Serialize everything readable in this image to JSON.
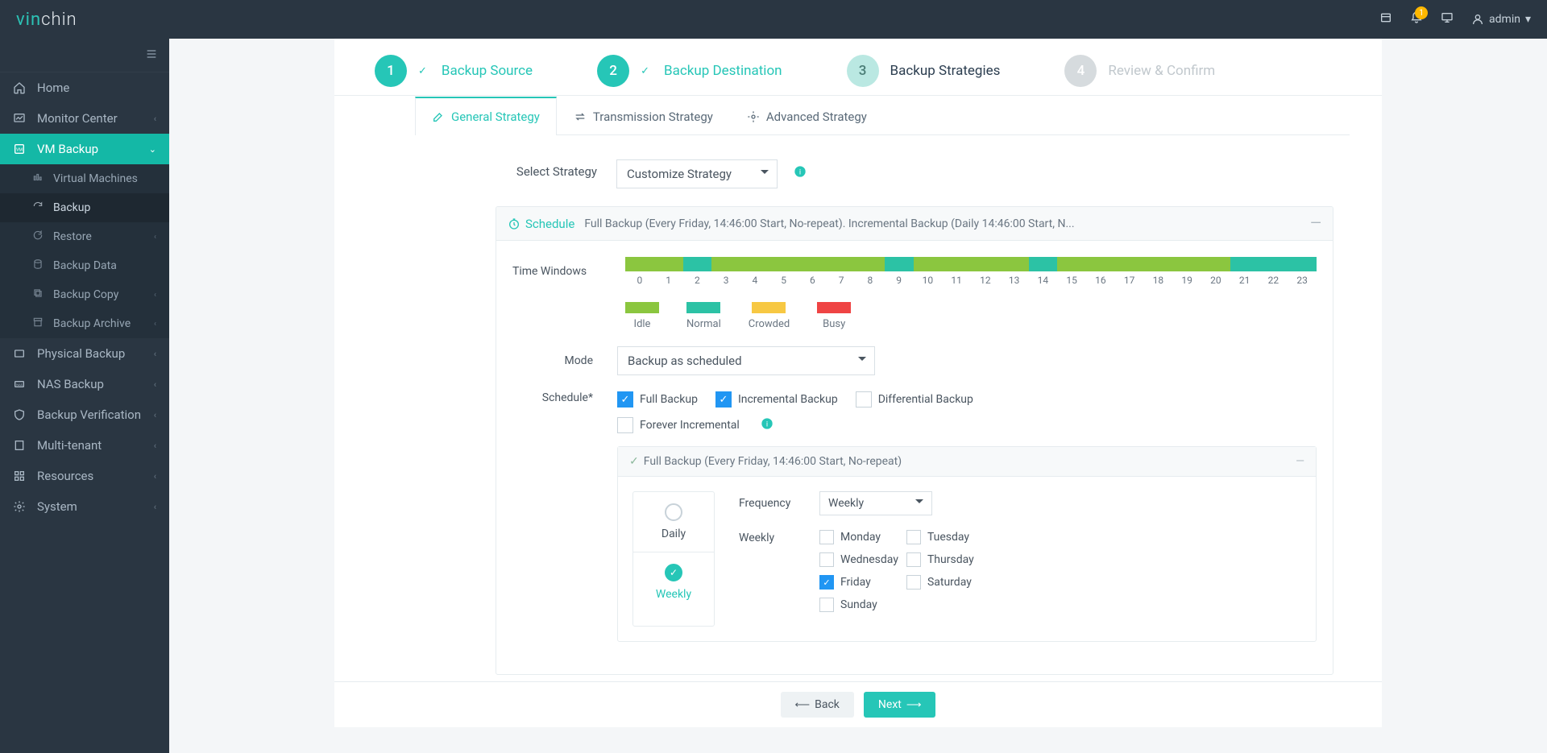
{
  "brand": {
    "prefix": "vin",
    "suffix": "chin"
  },
  "topbar": {
    "user": "admin",
    "notif_count": "1"
  },
  "sidebar": {
    "items": [
      {
        "label": "Home"
      },
      {
        "label": "Monitor Center"
      },
      {
        "label": "VM Backup"
      },
      {
        "label": "Physical Backup"
      },
      {
        "label": "NAS Backup"
      },
      {
        "label": "Backup Verification"
      },
      {
        "label": "Multi-tenant"
      },
      {
        "label": "Resources"
      },
      {
        "label": "System"
      }
    ],
    "vm_sub": [
      {
        "label": "Virtual Machines"
      },
      {
        "label": "Backup"
      },
      {
        "label": "Restore"
      },
      {
        "label": "Backup Data"
      },
      {
        "label": "Backup Copy"
      },
      {
        "label": "Backup Archive"
      }
    ]
  },
  "wizard": {
    "steps": [
      {
        "num": "1",
        "label": "Backup Source"
      },
      {
        "num": "2",
        "label": "Backup Destination"
      },
      {
        "num": "3",
        "label": "Backup Strategies"
      },
      {
        "num": "4",
        "label": "Review & Confirm"
      }
    ]
  },
  "tabs": {
    "general": "General Strategy",
    "transmission": "Transmission Strategy",
    "advanced": "Advanced Strategy"
  },
  "form": {
    "select_strategy_label": "Select Strategy",
    "select_strategy_value": "Customize Strategy",
    "schedule_title": "Schedule",
    "schedule_summary": "Full Backup (Every Friday, 14:46:00 Start, No-repeat). Incremental Backup (Daily 14:46:00 Start, N...",
    "time_windows_label": "Time Windows",
    "legend": {
      "idle": "Idle",
      "normal": "Normal",
      "crowded": "Crowded",
      "busy": "Busy"
    },
    "hours": [
      "0",
      "1",
      "2",
      "3",
      "4",
      "5",
      "6",
      "7",
      "8",
      "9",
      "10",
      "11",
      "12",
      "13",
      "14",
      "15",
      "16",
      "17",
      "18",
      "19",
      "20",
      "21",
      "22",
      "23"
    ],
    "hour_states": [
      "idle",
      "idle",
      "normal",
      "idle",
      "idle",
      "idle",
      "idle",
      "idle",
      "idle",
      "normal",
      "idle",
      "idle",
      "idle",
      "idle",
      "normal",
      "idle",
      "idle",
      "idle",
      "idle",
      "idle",
      "idle",
      "normal",
      "normal",
      "normal"
    ],
    "mode_label": "Mode",
    "mode_value": "Backup as scheduled",
    "schedule_label": "Schedule",
    "full_backup": "Full Backup",
    "incremental": "Incremental Backup",
    "differential": "Differential Backup",
    "forever_inc": "Forever Incremental",
    "accordion": {
      "title": "Full Backup (Every Friday, 14:46:00 Start, No-repeat)",
      "daily": "Daily",
      "weekly": "Weekly",
      "freq_label": "Frequency",
      "freq_value": "Weekly",
      "weekly_label": "Weekly",
      "days": [
        "Monday",
        "Tuesday",
        "Wednesday",
        "Thursday",
        "Friday",
        "Saturday",
        "Sunday"
      ]
    }
  },
  "footer": {
    "back": "Back",
    "next": "Next"
  }
}
